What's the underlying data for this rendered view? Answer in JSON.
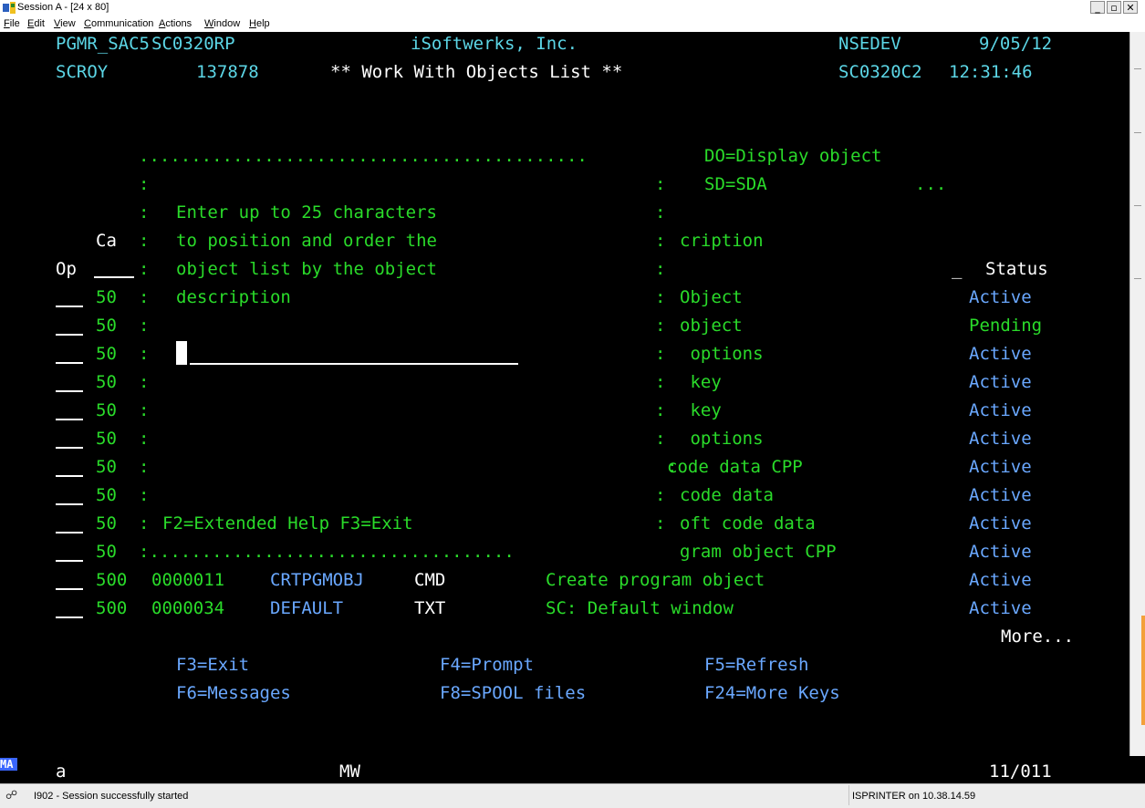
{
  "window": {
    "title": "Session A - [24 x 80]",
    "icons": [
      "session-app-icon",
      "minimize-icon",
      "maximize-icon",
      "close-icon"
    ]
  },
  "menubar": {
    "items": [
      {
        "label": "File",
        "accel": "F",
        "rest": "ile"
      },
      {
        "label": "Edit",
        "accel": "E",
        "rest": "dit"
      },
      {
        "label": "View",
        "accel": "V",
        "rest": "iew"
      },
      {
        "label": "Communication",
        "accel": "C",
        "rest": "ommunication"
      },
      {
        "label": "Actions",
        "accel": "A",
        "rest": "ctions"
      },
      {
        "label": "Window",
        "accel": "W",
        "rest": "indow"
      },
      {
        "label": "Help",
        "accel": "H",
        "rest": "elp"
      }
    ]
  },
  "header": {
    "user_program": "PGMR_SAC5",
    "program": "SC0320RP",
    "company": "iSoftwerks, Inc.",
    "system": "NSEDEV",
    "date": "9/05/12",
    "user": "SCROY",
    "job_number": "137878",
    "title": "** Work With Objects List **",
    "display_file": "SC0320C2",
    "time": "12:31:46"
  },
  "behind": {
    "opt_do": "DO=Display object",
    "opt_sd": "SD=SDA",
    "opt_more": "...",
    "ca_label": "Ca",
    "desc_fragment": "cription",
    "op_label": "Op",
    "status_header": "Status",
    "rows": [
      {
        "seq": "50",
        "desc": "Object",
        "status": "Active"
      },
      {
        "seq": "50",
        "desc": "object",
        "status": "Pending"
      },
      {
        "seq": "50",
        "desc": " options",
        "status": "Active"
      },
      {
        "seq": "50",
        "desc": " key",
        "status": "Active"
      },
      {
        "seq": "50",
        "desc": " key",
        "status": "Active"
      },
      {
        "seq": "50",
        "desc": " options",
        "status": "Active"
      },
      {
        "seq": "50",
        "desc": "code data CPP",
        "status": "Active"
      },
      {
        "seq": "50",
        "desc": "code data",
        "status": "Active"
      },
      {
        "seq": "50",
        "desc": "oft code data",
        "status": "Active"
      },
      {
        "seq": "50",
        "desc": "gram object CPP",
        "status": "Active"
      }
    ],
    "full_rows": [
      {
        "seq": "500",
        "id": "0000011",
        "name": "CRTPGMOBJ",
        "type": "CMD",
        "desc": "Create program object",
        "status": "Active"
      },
      {
        "seq": "500",
        "id": "0000034",
        "name": "DEFAULT",
        "type": "TXT",
        "desc": "SC: Default window",
        "status": "Active"
      }
    ],
    "more": "More..."
  },
  "popup": {
    "top_border": "...........................................",
    "bottom_border": ":...................................",
    "instructions": [
      "Enter up to 25 characters",
      "to position and order the",
      "object list by the object",
      "description"
    ],
    "position_field_value": "",
    "function_keys": "F2=Extended Help F3=Exit"
  },
  "function_keys": {
    "row1": [
      "F3=Exit",
      "F4=Prompt",
      "F5=Refresh"
    ],
    "row2": [
      "F6=Messages",
      "F8=SPOOL files",
      "F24=More Keys"
    ]
  },
  "oia": {
    "indicator": "MA",
    "mode": "a",
    "session_type": "MW",
    "cursor_position": "11/011"
  },
  "statusbar": {
    "message": "I902 - Session successfully started",
    "printer": "ISPRINTER on 10.38.14.59"
  },
  "colors": {
    "screen_bg": "#000000",
    "green": "#2adb2a",
    "white": "#ffffff",
    "blue": "#6aa8ff",
    "oia_indicator": "#3a66ff"
  }
}
